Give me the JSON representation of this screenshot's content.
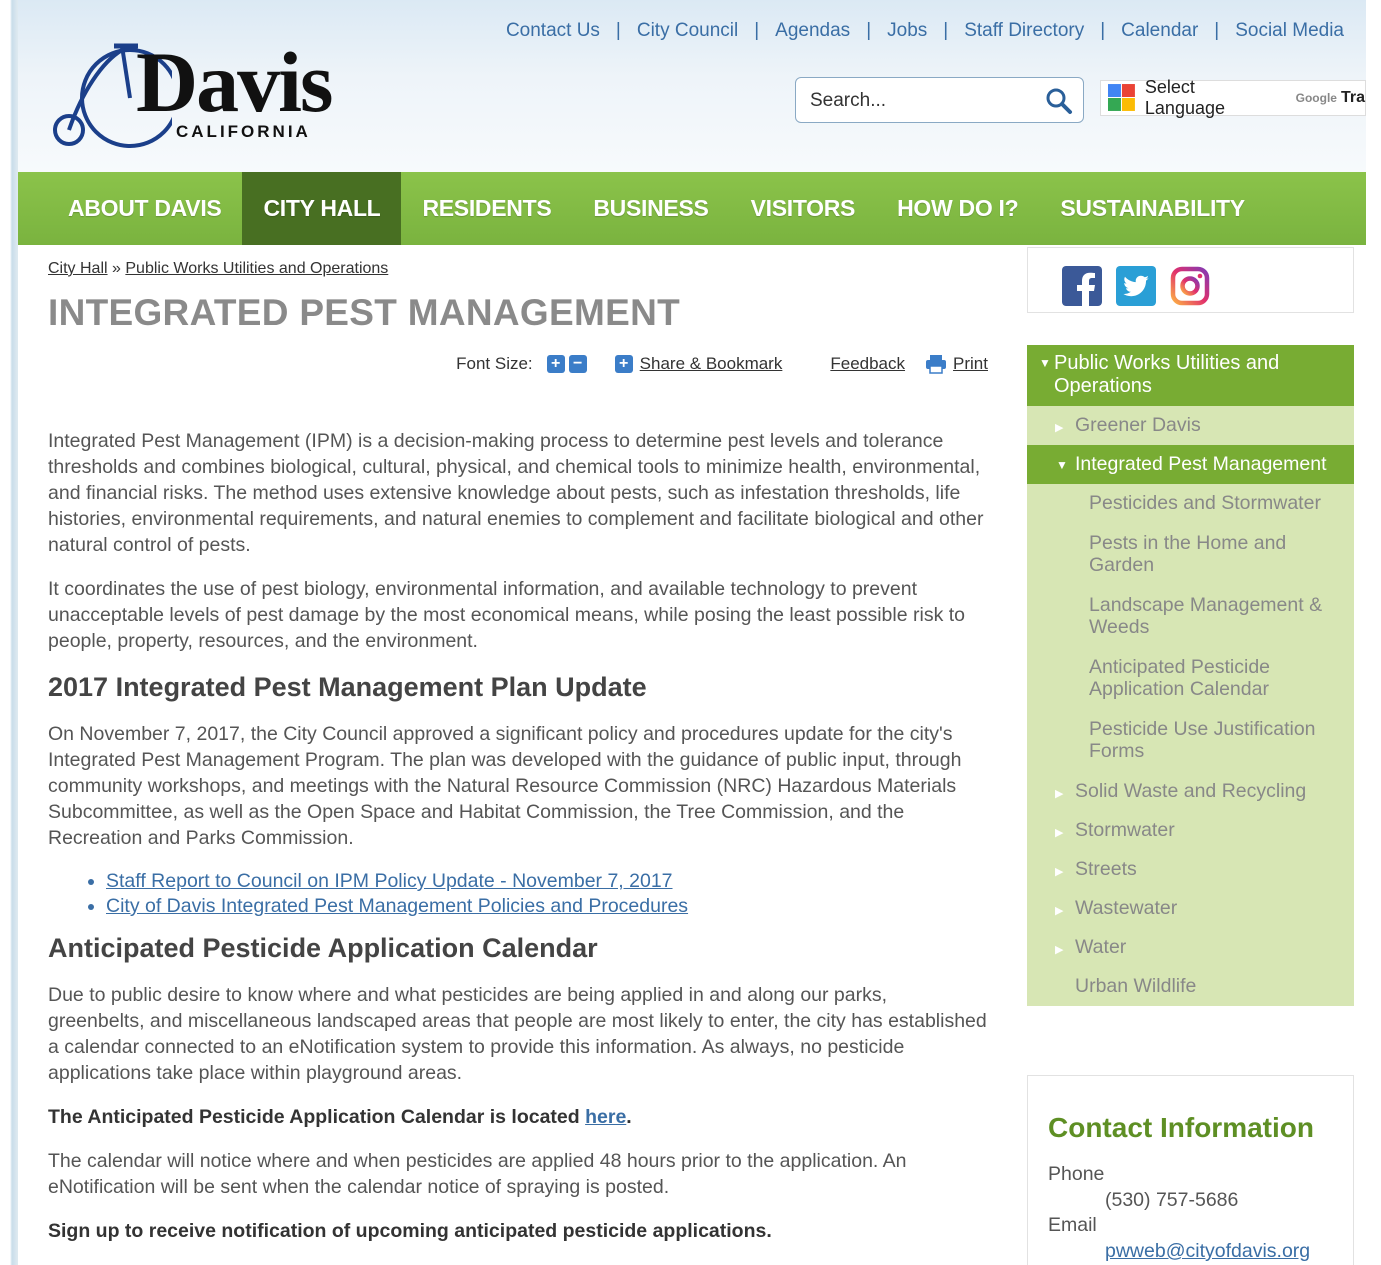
{
  "header": {
    "logo_text": "Davis",
    "logo_sub": "CALIFORNIA",
    "top_links": [
      "Contact Us",
      "City Council",
      "Agendas",
      "Jobs",
      "Staff Directory",
      "Calendar",
      "Social Media"
    ],
    "search_placeholder": "Search...",
    "translate_label": "Select Language",
    "translate_google": "Google",
    "translate_tr": "Tra"
  },
  "nav": {
    "items": [
      "ABOUT DAVIS",
      "CITY HALL",
      "RESIDENTS",
      "BUSINESS",
      "VISITORS",
      "HOW DO I?",
      "SUSTAINABILITY"
    ],
    "active": "CITY HALL"
  },
  "breadcrumb": {
    "items": [
      "City Hall",
      "Public Works Utilities and Operations"
    ],
    "separator": "»"
  },
  "page_title": "INTEGRATED PEST MANAGEMENT",
  "tools": {
    "font_size_label": "Font Size:",
    "plus": "+",
    "minus": "−",
    "share": "Share & Bookmark",
    "feedback": "Feedback",
    "print": "Print"
  },
  "content": {
    "intro_p1": "Integrated Pest Management (IPM) is a decision-making process to determine pest levels and tolerance thresholds and combines biological, cultural, physical, and chemical tools to minimize health, environmental, and financial risks. The method uses extensive knowledge about pests, such as infestation thresholds, life histories, environmental requirements, and natural enemies to complement and facilitate biological and other natural control of pests.",
    "intro_p2": "It coordinates the use of pest biology, environmental information, and available technology to prevent unacceptable levels of pest damage by the most economical means, while posing the least possible risk to people, property, resources, and the environment.",
    "h2_plan": "2017 Integrated Pest Management Plan Update",
    "plan_p": "On November 7, 2017, the City Council approved a significant policy and procedures update for the city's Integrated Pest Management Program. The plan was developed with the guidance of public input, through community workshops, and meetings with the Natural Resource Commission (NRC) Hazardous Materials Subcommittee, as well as the Open Space and Habitat Commission, the Tree Commission, and the Recreation and Parks Commission.",
    "links": [
      "Staff Report to Council on IPM Policy Update - November 7, 2017",
      "City of Davis Integrated Pest Management Policies and Procedures"
    ],
    "h2_calendar": "Anticipated Pesticide Application Calendar",
    "calendar_p1": "Due to public desire to know where and what pesticides are being applied in and along our parks, greenbelts, and miscellaneous landscaped areas that people are most likely to enter, the city has established a calendar connected to an eNotification system to provide this information. As always, no pesticide applications take place within playground areas.",
    "calendar_located_prefix": "The Anticipated Pesticide Application Calendar is located ",
    "calendar_located_link": "here",
    "calendar_located_suffix": ".",
    "calendar_p2": "The calendar will notice where and when pesticides are applied 48 hours prior to the application. An eNotification will be sent when the calendar notice of spraying is posted.",
    "signup": "Sign up to receive notification of upcoming anticipated pesticide applications."
  },
  "sidebar": {
    "social": [
      "facebook-icon",
      "twitter-icon",
      "instagram-icon"
    ],
    "section_title": "Public Works Utilities and Operations",
    "items": [
      {
        "label": "Greener Davis"
      },
      {
        "label": "Integrated Pest Management",
        "active": true,
        "children": [
          "Pesticides and Stormwater",
          "Pests in the Home and Garden",
          "Landscape Management & Weeds",
          "Anticipated Pesticide Application Calendar",
          "Pesticide Use Justification Forms"
        ]
      },
      {
        "label": "Solid Waste and Recycling"
      },
      {
        "label": "Stormwater"
      },
      {
        "label": "Streets"
      },
      {
        "label": "Wastewater"
      },
      {
        "label": "Water"
      },
      {
        "label": "Urban Wildlife"
      }
    ]
  },
  "contact": {
    "title": "Contact Information",
    "phone_label": "Phone",
    "phone": "(530) 757-5686",
    "email_label": "Email",
    "email": "pwweb@cityofdavis.org"
  },
  "colors": {
    "nav_green": "#7ab33f",
    "nav_active": "#486f22",
    "sidebar_bg": "#d7e6b4",
    "link_blue": "#3a6ea5",
    "contact_title": "#5e8f24"
  }
}
